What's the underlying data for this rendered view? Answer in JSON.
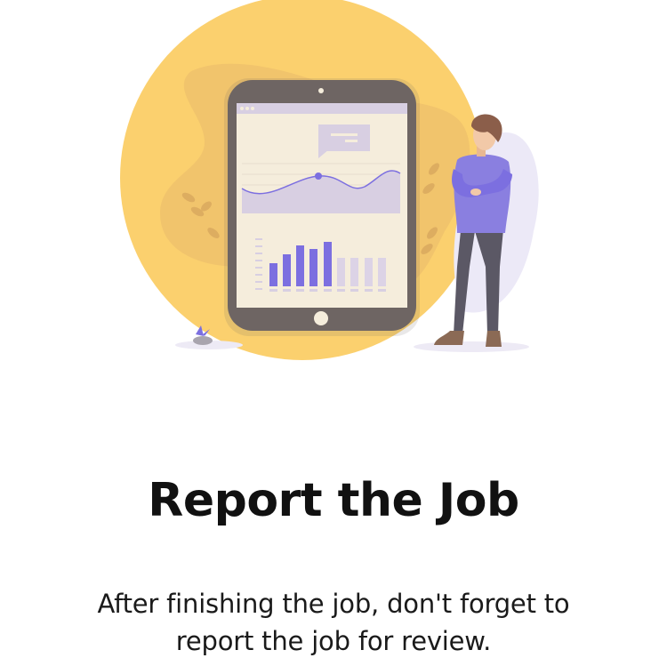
{
  "onboarding": {
    "illustration": {
      "icon": "tablet-report-illustration",
      "colors": {
        "sun": "#FBD06E",
        "blob": "#EEC06C",
        "tablet_frame": "#6E6563",
        "screen": "#F5EDDC",
        "bars_accent": "#7C6FE0",
        "bars_muted": "#DCD3E6",
        "person_shirt": "#8A7FE0",
        "person_pants": "#5B5865"
      }
    },
    "title": "Report the Job",
    "description": "After finishing the job, don't forget to report the job for review."
  }
}
